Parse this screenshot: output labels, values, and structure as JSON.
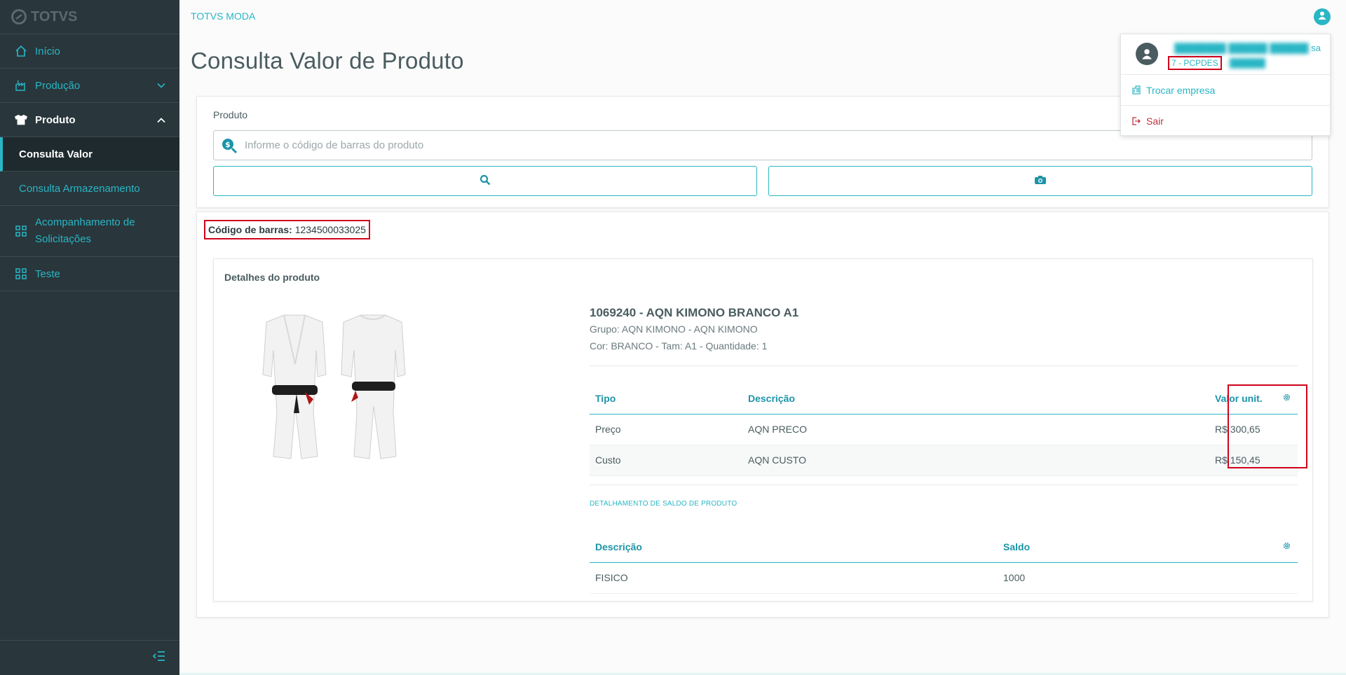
{
  "sidebar": {
    "logo": "TOTVS",
    "items": [
      {
        "label": "Início",
        "icon": "home-icon"
      },
      {
        "label": "Produção",
        "icon": "factory-icon"
      },
      {
        "label": "Produto",
        "icon": "shirt-icon"
      },
      {
        "label": "Consulta Valor"
      },
      {
        "label": "Consulta Armazenamento"
      },
      {
        "label_line1": "Acompanhamento de",
        "label_line2": "Solicitações",
        "icon": "grid-icon"
      },
      {
        "label": "Teste",
        "icon": "grid-icon"
      }
    ]
  },
  "header": {
    "app_name": "TOTVS MODA",
    "page_title": "Consulta Valor de Produto"
  },
  "search": {
    "label": "Produto",
    "placeholder": "Informe o código de barras do produto",
    "value": ""
  },
  "result": {
    "barcode_label": "Código de barras:",
    "barcode_value": "1234500033025",
    "details_title": "Detalhes do produto",
    "product_name": "1069240 - AQN KIMONO BRANCO A1",
    "grupo": "Grupo: AQN KIMONO - AQN KIMONO",
    "cor": "Cor: BRANCO - Tam: A1 - Quantidade: 1",
    "price_table": {
      "headers": [
        "Tipo",
        "Descrição",
        "Valor unit."
      ],
      "rows": [
        {
          "tipo": "Preço",
          "descricao": "AQN PRECO",
          "valor": "R$ 300,65"
        },
        {
          "tipo": "Custo",
          "descricao": "AQN CUSTO",
          "valor": "R$ 150,45"
        }
      ]
    },
    "saldo_title": "DETALHAMENTO DE SALDO DE PRODUTO",
    "saldo_table": {
      "headers": [
        "Descrição",
        "Saldo"
      ],
      "rows": [
        {
          "descricao": "FISICO",
          "saldo": "1000"
        }
      ]
    }
  },
  "user_menu": {
    "name_visible_suffix": "sa",
    "company_code": "7 - PCPDES",
    "trocar_empresa": "Trocar empresa",
    "sair": "Sair"
  },
  "colors": {
    "accent": "#29b6c5",
    "sidebar_bg": "#29363b",
    "highlight_box": "#d0021b",
    "logout": "#c0313f"
  }
}
